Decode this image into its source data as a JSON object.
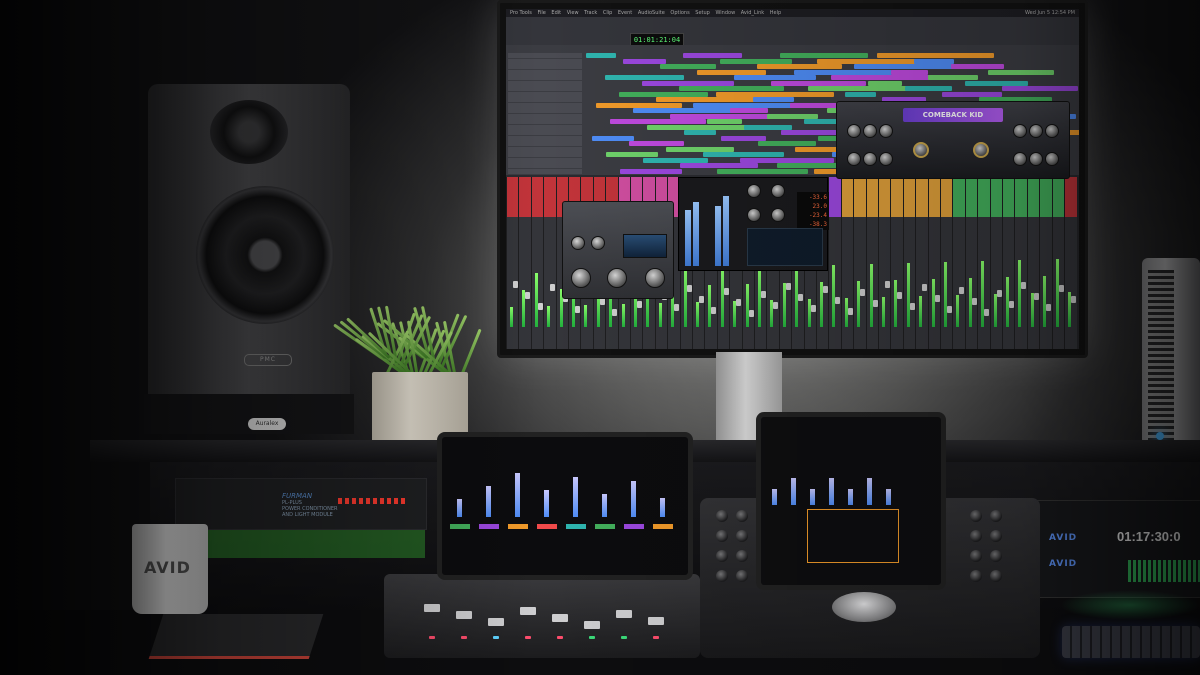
{
  "monitor": {
    "app_name": "Pro Tools",
    "menu_items": [
      "Pro Tools",
      "File",
      "Edit",
      "View",
      "Track",
      "Clip",
      "Event",
      "AudioSuite",
      "Options",
      "Setup",
      "Window",
      "Avid_Link",
      "Help"
    ],
    "clock": "Wed Jun 5  12:54 PM",
    "counter": "01:01:21:04",
    "plugin_title": "COMEBACK KID",
    "eq_readouts": [
      "-33.6",
      "23.0",
      "-23.4",
      "-38.3"
    ]
  },
  "speaker": {
    "badge": "PMC",
    "stand_label": "Auralex"
  },
  "rack": {
    "unit_label": "FURMAN",
    "unit_text": "PL-PLUS\nPOWER CONDITIONER\nAND LIGHT MODULE"
  },
  "mug": {
    "logo": "AVID"
  },
  "avid_interface": {
    "logo_top": "AVID",
    "logo_bottom": "AVID",
    "timecode": "01:17:30:0"
  },
  "colors": {
    "accent_purple": "#9c48e0",
    "accent_green": "#43b05c",
    "accent_orange": "#f29b2a",
    "accent_red": "#f14a4a",
    "meter_blue": "#4f8df7"
  }
}
